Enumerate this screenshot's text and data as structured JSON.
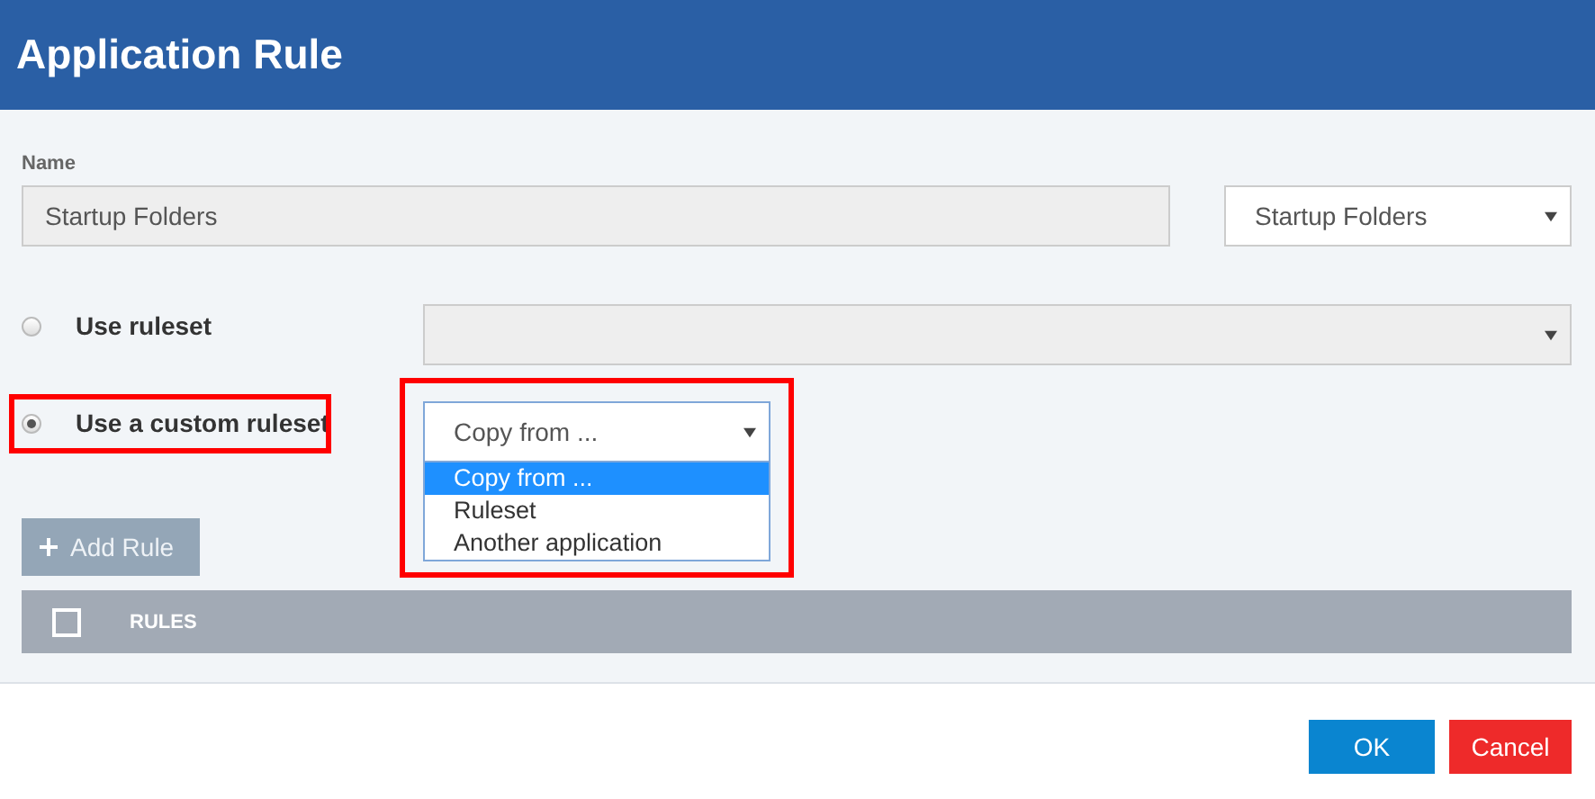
{
  "window": {
    "title": "Application Rule"
  },
  "name_field": {
    "label": "Name",
    "value": "Startup Folders",
    "disabled": true
  },
  "type_select": {
    "value": "Startup Folders"
  },
  "options": [
    {
      "label": "Use ruleset",
      "selected": false,
      "highlighted": false,
      "select": {
        "disabled": true
      }
    },
    {
      "label": "Use a custom ruleset",
      "selected": true,
      "highlighted": true,
      "select": {
        "value": "Copy from ...",
        "disabled": false,
        "open": true,
        "highlighted": true,
        "items": [
          {
            "label": "Copy from ...",
            "selected": true
          },
          {
            "label": "Ruleset",
            "selected": false
          },
          {
            "label": "Another application",
            "selected": false
          }
        ]
      }
    }
  ],
  "add_rule_button": {
    "label": "Add Rule",
    "disabled": true
  },
  "rules_table": {
    "header_checked": false,
    "columns": [
      "RULES"
    ]
  },
  "buttons": [
    {
      "label": "OK",
      "kind": "primary"
    },
    {
      "label": "Cancel",
      "kind": "danger"
    }
  ]
}
